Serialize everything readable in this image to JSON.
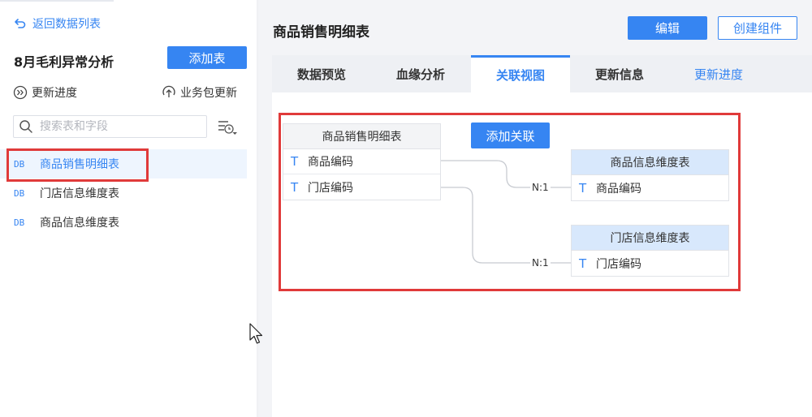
{
  "sidebar": {
    "back_label": "返回数据列表",
    "package_title": "8月毛利异常分析",
    "add_table_label": "添加表",
    "update_progress_label": "更新进度",
    "package_update_label": "业务包更新",
    "search_placeholder": "搜索表和字段",
    "tables": [
      {
        "tag": "DB",
        "name": "商品销售明细表"
      },
      {
        "tag": "DB",
        "name": "门店信息维度表"
      },
      {
        "tag": "DB",
        "name": "商品信息维度表"
      }
    ]
  },
  "header": {
    "title": "商品销售明细表",
    "edit_label": "编辑",
    "create_component_label": "创建组件"
  },
  "tabs": [
    {
      "label": "数据预览"
    },
    {
      "label": "血缘分析"
    },
    {
      "label": "关联视图"
    },
    {
      "label": "更新信息"
    },
    {
      "label": "更新进度"
    }
  ],
  "diagram": {
    "add_relation_label": "添加关联",
    "source_table": {
      "name": "商品销售明细表",
      "fields": [
        {
          "type": "T",
          "name": "商品编码"
        },
        {
          "type": "T",
          "name": "门店编码"
        }
      ]
    },
    "targets": [
      {
        "name": "商品信息维度表",
        "cardinality": "N:1",
        "fields": [
          {
            "type": "T",
            "name": "商品编码"
          }
        ]
      },
      {
        "name": "门店信息维度表",
        "cardinality": "N:1",
        "fields": [
          {
            "type": "T",
            "name": "门店编码"
          }
        ]
      }
    ]
  },
  "colors": {
    "accent": "#3685f2",
    "highlight": "#e03a3a"
  },
  "icons": {
    "back": "back-arrow-icon",
    "update_progress": "double-chevron-circle-icon",
    "package_update": "upload-circle-icon",
    "search": "search-icon",
    "filter": "filter-clock-icon",
    "cursor": "mouse-pointer-icon"
  }
}
